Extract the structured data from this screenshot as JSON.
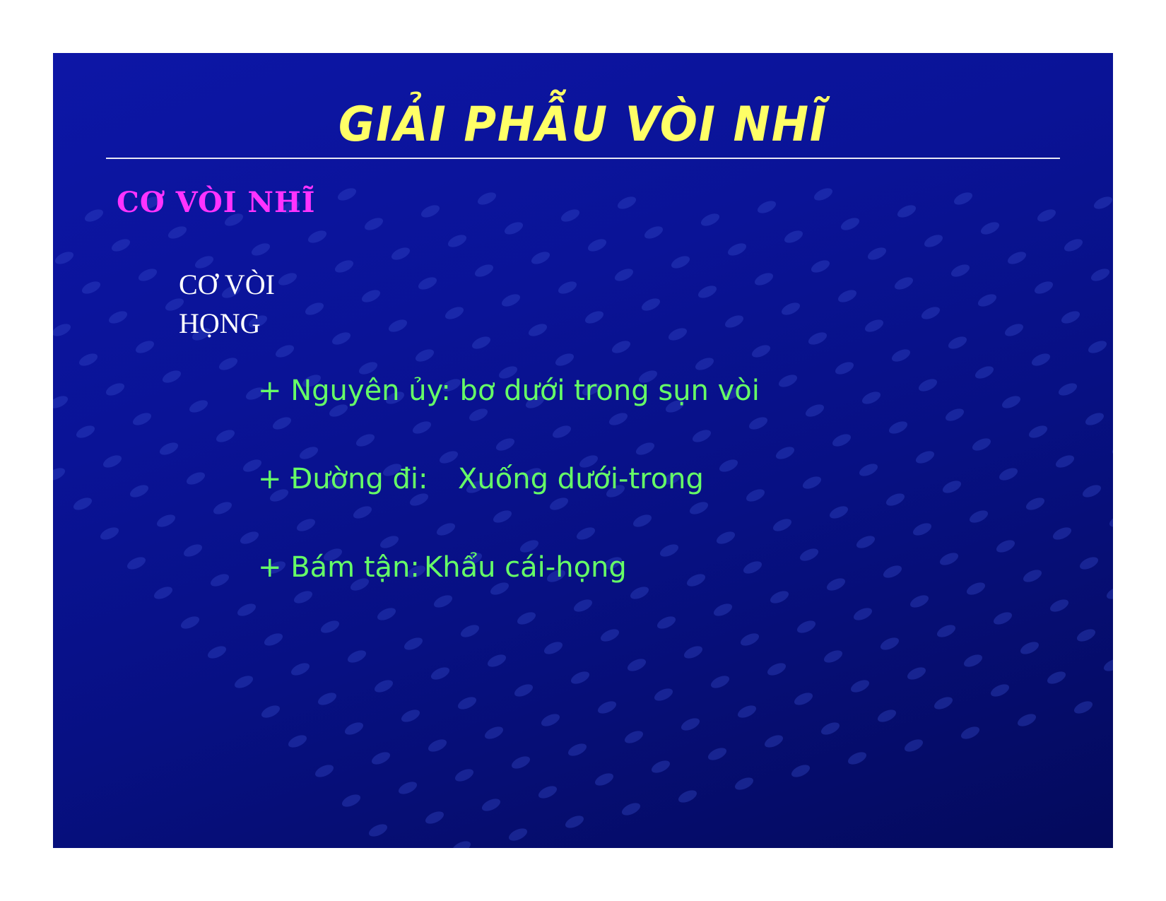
{
  "slide": {
    "title": "GIẢI PHẪU VÒI NHĨ",
    "subtitle": "CƠ VÒI NHĨ",
    "muscle_name": [
      "CƠ VÒI",
      "HỌNG"
    ],
    "details": [
      {
        "label": "+ Nguyên ủy: bơ dưới trong sụn vòi",
        "value": ""
      },
      {
        "label": "+ Đường đi:",
        "value": "Xuống dưới-trong"
      },
      {
        "label": "+ Bám tận:",
        "value": "Khẩu cái-họng"
      }
    ]
  },
  "colors": {
    "background": "#0a1396",
    "title": "#ffff66",
    "subtitle": "#ff33ff",
    "muscle_name": "#ffffff",
    "details": "#66ff66",
    "rule": "#e8e8f4"
  }
}
